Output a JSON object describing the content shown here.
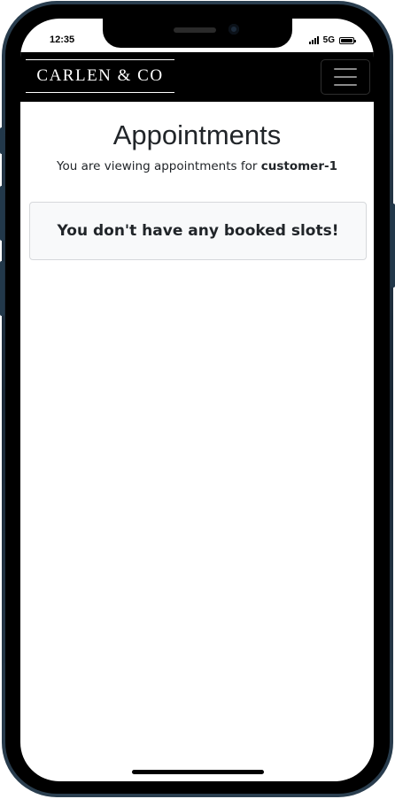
{
  "status_bar": {
    "time": "12:35",
    "network": "5G",
    "icons": [
      "signal-icon",
      "battery-icon"
    ]
  },
  "navbar": {
    "brand": "CARLEN & CO",
    "menu_icon": "hamburger-menu-icon"
  },
  "main": {
    "title": "Appointments",
    "subtitle_prefix": "You are viewing appointments for ",
    "customer_name": "customer-1",
    "empty_message": "You don't have any booked slots!"
  },
  "colors": {
    "navbar_background": "#000000",
    "alert_background": "#f8f9fa",
    "alert_border": "#d6d8db",
    "text": "#212529"
  }
}
